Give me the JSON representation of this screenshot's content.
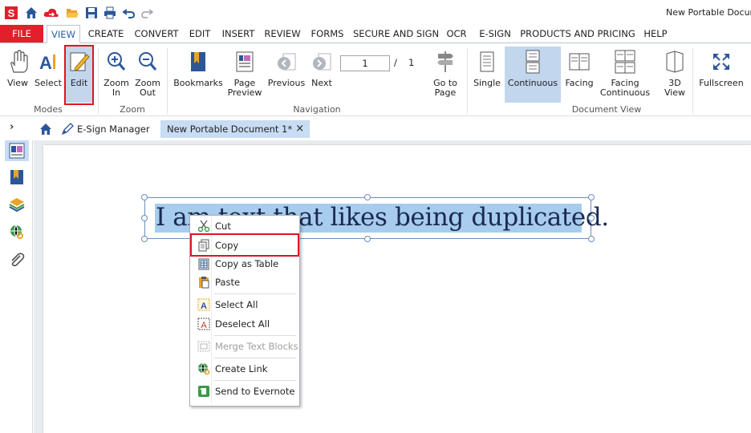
{
  "window": {
    "title": "New Portable Document"
  },
  "quick_access": [
    "app-logo-icon",
    "home-icon",
    "cloud-icon",
    "folder-open-icon",
    "save-icon",
    "print-icon",
    "undo-icon",
    "redo-icon"
  ],
  "menu": {
    "tabs": [
      "FILE",
      "VIEW",
      "CREATE",
      "CONVERT",
      "EDIT",
      "INSERT",
      "REVIEW",
      "FORMS",
      "SECURE AND SIGN",
      "OCR",
      "E-SIGN",
      "PRODUCTS AND PRICING",
      "HELP"
    ],
    "active": "VIEW"
  },
  "ribbon": {
    "modes": {
      "label": "Modes",
      "view": "View",
      "select": "Select",
      "edit": "Edit"
    },
    "zoom": {
      "label": "Zoom",
      "zoom_in": "Zoom\nIn",
      "zoom_out": "Zoom\nOut"
    },
    "navigation": {
      "label": "Navigation",
      "bookmarks": "Bookmarks",
      "page_preview": "Page\nPreview",
      "previous": "Previous",
      "next": "Next",
      "page_value": "1",
      "page_separator": "/",
      "page_total": "1",
      "go_to_page": "Go to\nPage"
    },
    "document_view": {
      "label": "Document View",
      "single": "Single",
      "continuous": "Continuous",
      "facing": "Facing",
      "facing_continuous": "Facing\nContinuous",
      "view_3d": "3D\nView",
      "fullscreen": "Fullscreen"
    }
  },
  "tabs": {
    "expand": "›",
    "esign_manager": "E-Sign Manager",
    "document": "New Portable Document 1*",
    "close": "×"
  },
  "document": {
    "text": "I am text that likes being duplicated."
  },
  "context_menu": {
    "cut": "Cut",
    "copy": "Copy",
    "copy_as_table": "Copy as Table",
    "paste": "Paste",
    "select_all": "Select All",
    "deselect_all": "Deselect All",
    "merge_text_blocks": "Merge Text Blocks",
    "create_link": "Create Link",
    "send_to_evernote": "Send to Evernote"
  },
  "colors": {
    "brand_red": "#e2202c",
    "selection": "#a8ccec",
    "ribbon_selected": "#c2d6ee",
    "highlight_box": "#e0151f"
  }
}
